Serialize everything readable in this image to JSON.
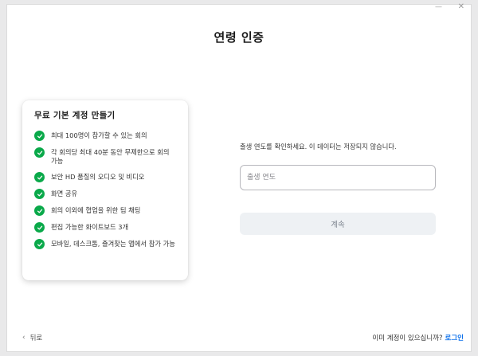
{
  "page": {
    "title": "연령 인증"
  },
  "card": {
    "title": "무료 기본 계정 만들기",
    "check_color": "#0aa94a",
    "features": [
      "최대 100명이 참가할 수 있는 회의",
      "각 회의당 최대 40분 동안 무제한으로 회의 가능",
      "보안 HD 품질의 오디오 및 비디오",
      "화면 공유",
      "회의 이외에 협업을 위한 팀 채팅",
      "편집 가능한 화이트보드 3개",
      "모바일, 데스크톱, 즐겨찾는 앱에서 참가 가능"
    ]
  },
  "form": {
    "prompt": "출생 연도를 확인하세요. 이 데이터는 저장되지 않습니다.",
    "year_placeholder": "출생 연도",
    "year_value": "",
    "continue_label": "계속"
  },
  "footer": {
    "back_label": "뒤로",
    "signin_question": "이미 계정이 있으십니까?",
    "signin_link": "로그인",
    "link_color": "#0e71eb"
  },
  "window": {
    "controls": [
      "minimize-icon",
      "close-icon"
    ]
  }
}
